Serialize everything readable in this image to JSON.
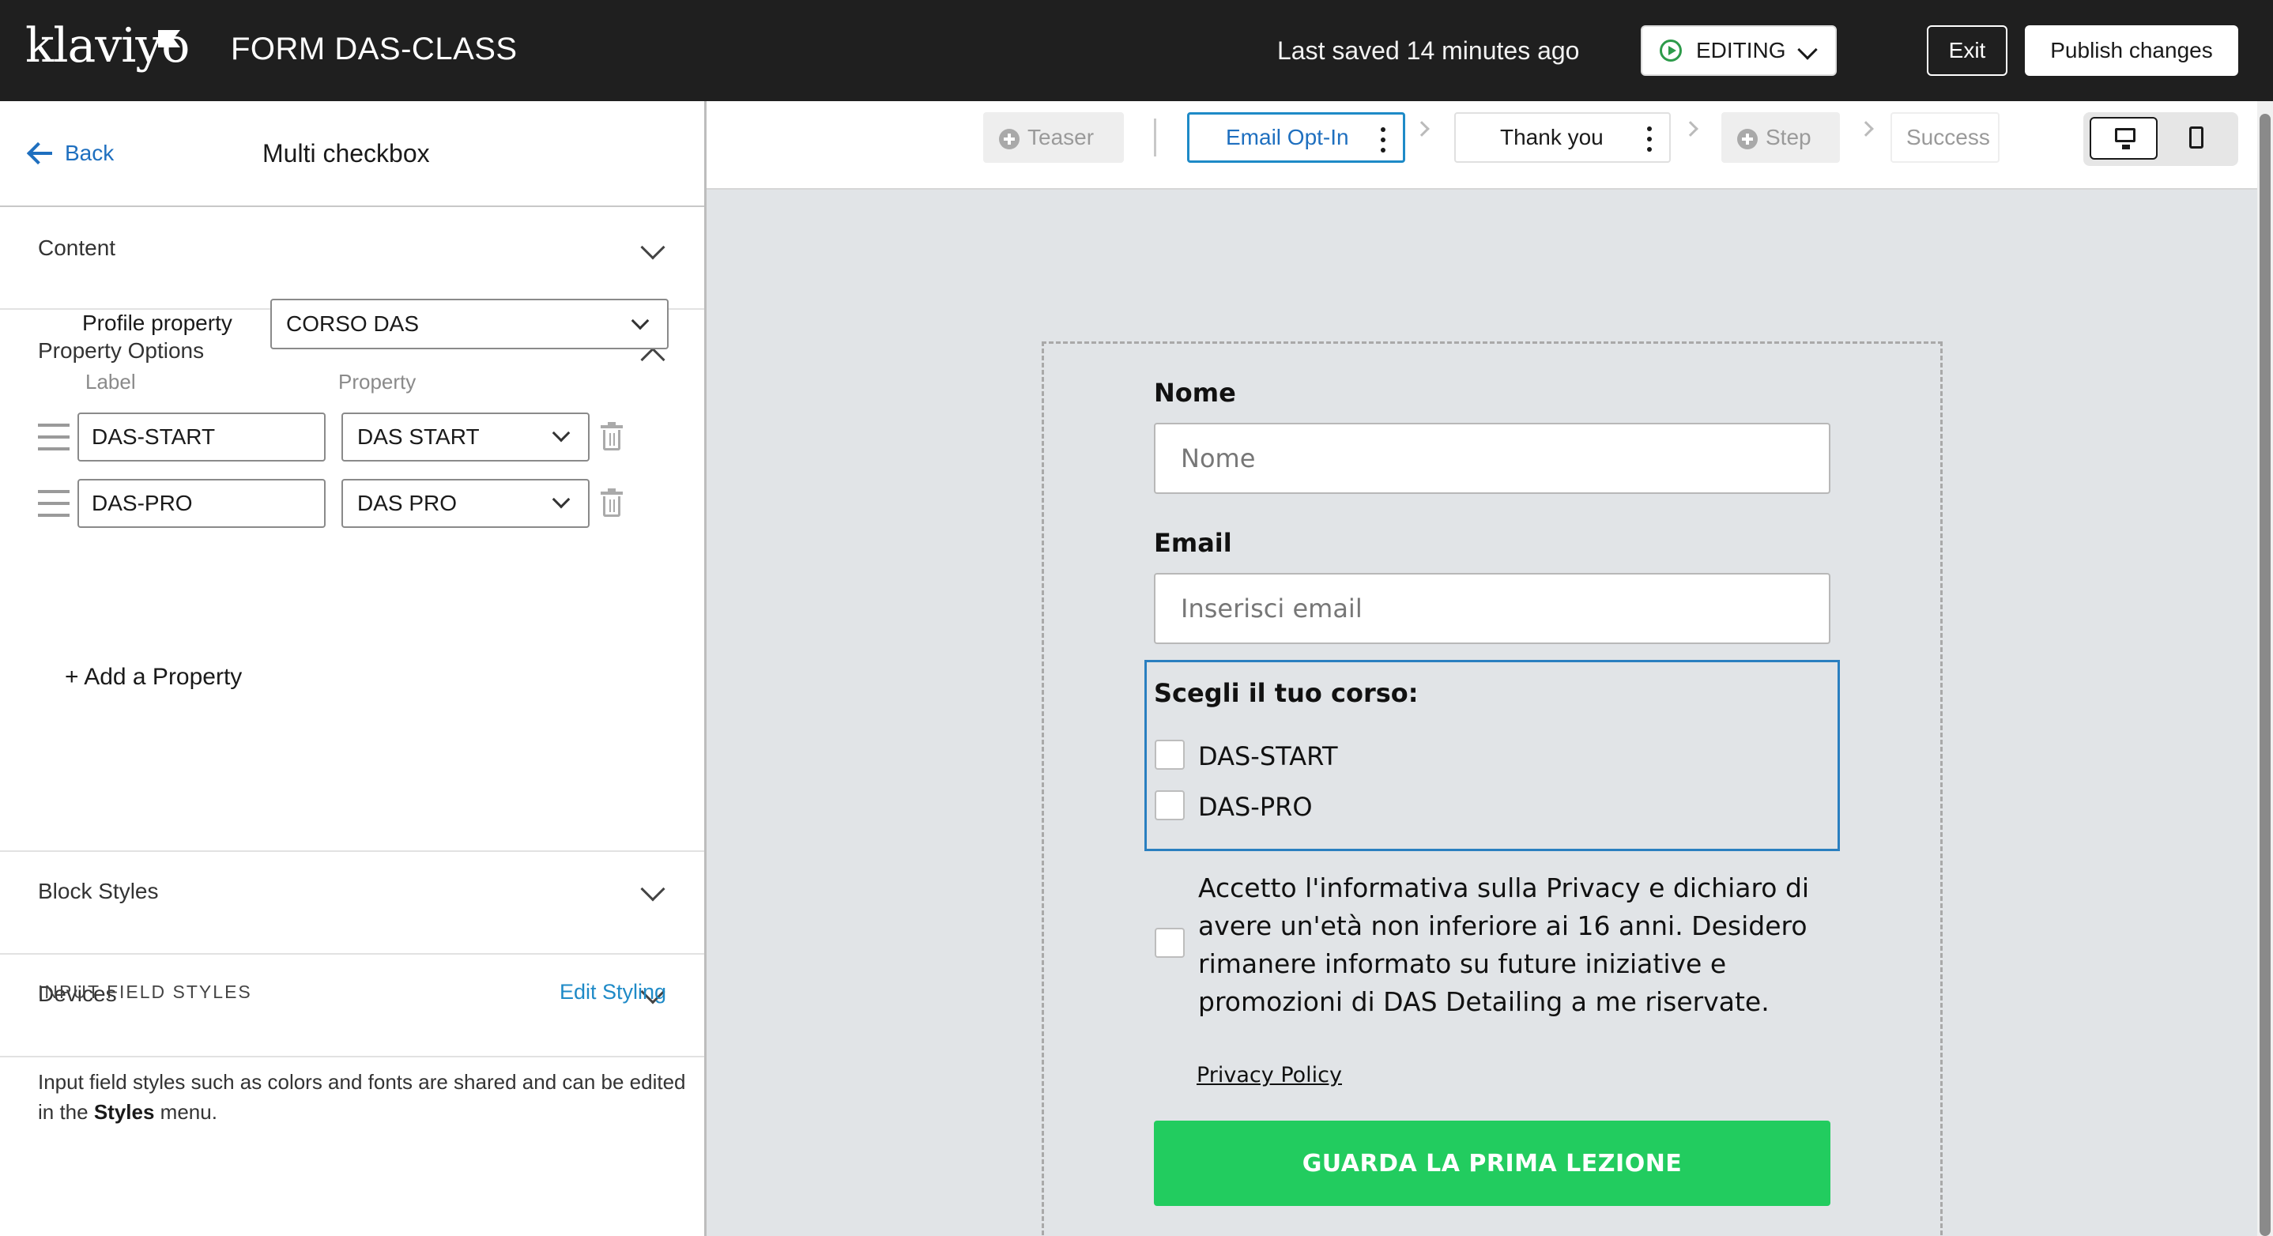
{
  "topbar": {
    "logo": "klaviyo",
    "form_title": "FORM DAS-CLASS",
    "last_saved": "Last saved 14 minutes ago",
    "status": "EDITING",
    "exit_label": "Exit",
    "publish_label": "Publish changes"
  },
  "left_panel": {
    "back_label": "Back",
    "title": "Multi checkbox",
    "sections": {
      "content": "Content",
      "property_options": "Property Options",
      "block_styles": "Block Styles",
      "devices": "Devices"
    },
    "profile_property_label": "Profile property",
    "profile_property_value": "CORSO DAS",
    "col_label": "Label",
    "col_property": "Property",
    "rows": [
      {
        "label": "DAS-START",
        "property": "DAS START"
      },
      {
        "label": "DAS-PRO",
        "property": "DAS PRO"
      }
    ],
    "add_property": "+ Add a Property",
    "input_field_styles": "INPUT FIELD STYLES",
    "edit_styling": "Edit Styling",
    "ifs_desc_pre": "Input field styles such as colors and fonts are shared and can be edited in the ",
    "ifs_desc_bold": "Styles",
    "ifs_desc_post": " menu."
  },
  "steps": {
    "teaser": "Teaser",
    "email_optin": "Email Opt-In",
    "thank_you": "Thank you",
    "step": "Step",
    "success": "Success"
  },
  "form": {
    "name_label": "Nome",
    "name_placeholder": "Nome",
    "email_label": "Email",
    "email_placeholder": "Inserisci email",
    "checkbox_title": "Scegli il tuo corso:",
    "options": [
      "DAS-START",
      "DAS-PRO"
    ],
    "consent": "Accetto l'informativa sulla Privacy e dichiaro di avere un'età non inferiore ai 16 anni. Desidero rimanere informato su future iniziative e promozioni di DAS Detailing a me riservate.",
    "privacy_link": "Privacy Policy",
    "cta": "GUARDA LA PRIMA LEZIONE"
  },
  "icons": {
    "back": "arrow-left-icon",
    "editing": "play-circle-icon",
    "drag": "drag-handle-icon",
    "delete": "trash-icon",
    "add_step": "plus-circle-icon",
    "more": "kebab-menu-icon",
    "desktop": "desktop-icon",
    "mobile": "mobile-icon"
  },
  "colors": {
    "topbar_bg": "#1f1f1f",
    "link_blue": "#1e6fbf",
    "active_step_border": "#1e8ac7",
    "selected_block_border": "#2a7fc0",
    "cta_green": "#22cc5f",
    "editing_green": "#2d9b4a",
    "canvas_bg": "#e1e4e7"
  }
}
